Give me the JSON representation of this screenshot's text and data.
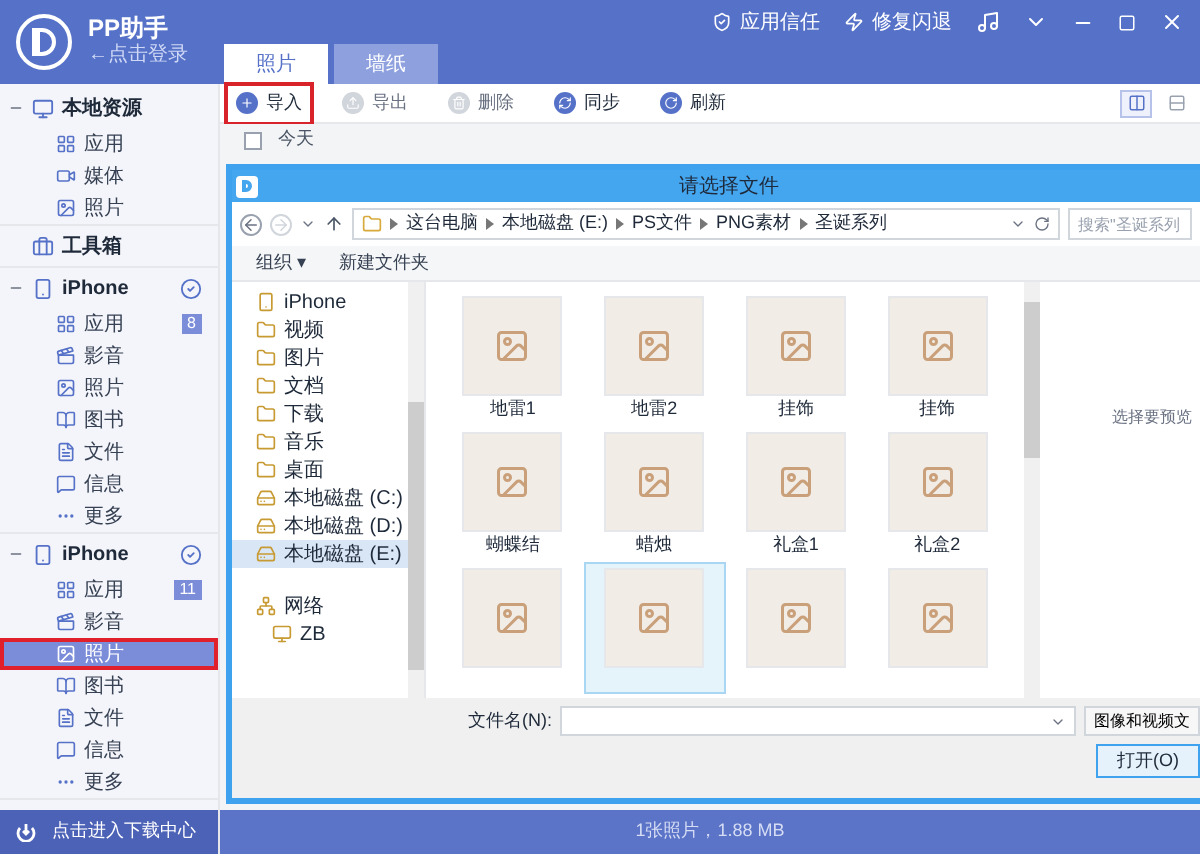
{
  "app": {
    "name": "PP助手",
    "login": "←点击登录"
  },
  "header_actions": [
    {
      "kind": "trust",
      "label": "应用信任"
    },
    {
      "kind": "repair",
      "label": "修复闪退"
    }
  ],
  "tabs": [
    {
      "label": "照片",
      "selected": true
    },
    {
      "label": "墙纸",
      "selected": false
    }
  ],
  "sidebar": {
    "groups": [
      {
        "kind": "local",
        "title": "本地资源",
        "items": [
          {
            "label": "应用",
            "selected": false
          },
          {
            "label": "媒体",
            "selected": false
          },
          {
            "label": "照片",
            "selected": false
          }
        ]
      },
      {
        "kind": "tools",
        "title": "工具箱"
      },
      {
        "kind": "device",
        "title": "iPhone",
        "checked": true,
        "items": [
          {
            "label": "应用",
            "badge": "8",
            "selected": false
          },
          {
            "label": "影音",
            "selected": false
          },
          {
            "label": "照片",
            "selected": false
          },
          {
            "label": "图书",
            "selected": false
          },
          {
            "label": "文件",
            "selected": false
          },
          {
            "label": "信息",
            "selected": false
          },
          {
            "label": "更多",
            "selected": false
          }
        ]
      },
      {
        "kind": "device",
        "title": "iPhone",
        "checked": true,
        "items": [
          {
            "label": "应用",
            "badge": "11",
            "selected": false
          },
          {
            "label": "影音",
            "selected": false
          },
          {
            "label": "照片",
            "selected": true
          },
          {
            "label": "图书",
            "selected": false
          },
          {
            "label": "文件",
            "selected": false
          },
          {
            "label": "信息",
            "selected": false
          },
          {
            "label": "更多",
            "selected": false
          }
        ]
      }
    ],
    "footer": "点击进入下载中心"
  },
  "toolbar": [
    {
      "kind": "import",
      "label": "导入",
      "disabled": false,
      "highlighted": true
    },
    {
      "kind": "export",
      "label": "导出",
      "disabled": true,
      "highlighted": false
    },
    {
      "kind": "delete",
      "label": "删除",
      "disabled": true,
      "highlighted": false
    },
    {
      "kind": "sync",
      "label": "同步",
      "disabled": false,
      "highlighted": false
    },
    {
      "kind": "refresh",
      "label": "刷新",
      "disabled": false,
      "highlighted": false
    }
  ],
  "view_modes": [
    {
      "selected": true
    },
    {
      "selected": false
    }
  ],
  "date_group": {
    "label": "今天",
    "checked": false
  },
  "dialog": {
    "title": "请选择文件",
    "breadcrumbs": [
      "这台电脑",
      "本地磁盘 (E:)",
      "PS文件",
      "PNG素材",
      "圣诞系列"
    ],
    "search_placeholder": "搜索\"圣诞系列",
    "organize": "组织 ▾",
    "new_folder": "新建文件夹",
    "nav": [
      {
        "kind": "phone",
        "label": "iPhone",
        "selected": false
      },
      {
        "kind": "folder",
        "label": "视频",
        "selected": false
      },
      {
        "kind": "folder",
        "label": "图片",
        "selected": false
      },
      {
        "kind": "folder",
        "label": "文档",
        "selected": false
      },
      {
        "kind": "folder",
        "label": "下载",
        "selected": false
      },
      {
        "kind": "folder",
        "label": "音乐",
        "selected": false
      },
      {
        "kind": "folder",
        "label": "桌面",
        "selected": false
      },
      {
        "kind": "drive",
        "label": "本地磁盘 (C:)",
        "selected": false
      },
      {
        "kind": "drive",
        "label": "本地磁盘 (D:)",
        "selected": false
      },
      {
        "kind": "drive",
        "label": "本地磁盘 (E:)",
        "selected": true
      },
      {
        "kind": "network",
        "label": "网络",
        "selected": false,
        "children": [
          {
            "kind": "computer",
            "label": "ZB",
            "selected": false
          }
        ]
      }
    ],
    "files": [
      {
        "label": "地雷1",
        "selected": false
      },
      {
        "label": "地雷2",
        "selected": false
      },
      {
        "label": "挂饰",
        "selected": false
      },
      {
        "label": "挂饰",
        "selected": false
      },
      {
        "label": "蝴蝶结",
        "selected": false
      },
      {
        "label": "蜡烛",
        "selected": false
      },
      {
        "label": "礼盒1",
        "selected": false
      },
      {
        "label": "礼盒2",
        "selected": false
      },
      {
        "selected": false
      },
      {
        "selected": true
      },
      {
        "selected": false
      },
      {
        "selected": false
      }
    ],
    "preview_hint": "选择要预览",
    "filename_label": "文件名(N):",
    "filter": "图像和视频文",
    "open_button": "打开(O)"
  },
  "status_bar": "1张照片，1.88 MB"
}
